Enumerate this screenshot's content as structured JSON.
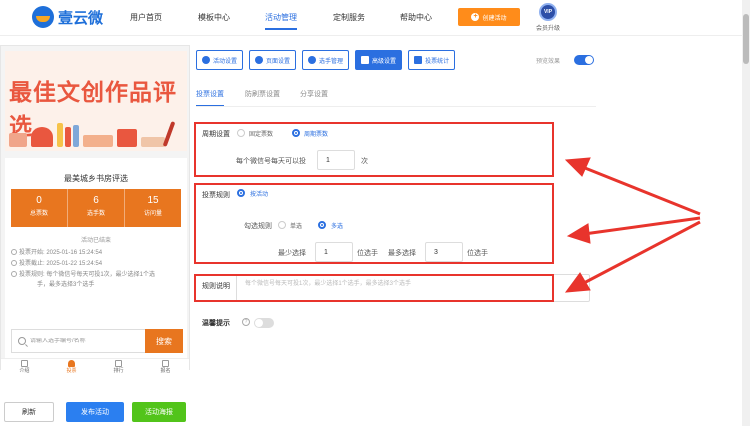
{
  "header": {
    "logo_text": "壹云微",
    "nav": [
      {
        "label": "用户首页"
      },
      {
        "label": "模板中心"
      },
      {
        "label": "活动管理"
      },
      {
        "label": "定制服务"
      },
      {
        "label": "帮助中心"
      }
    ],
    "create_button": "创建活动",
    "vip_badge": "VIP",
    "vip_label": "会员升级"
  },
  "preview": {
    "banner_title": "最佳文创作品评选",
    "activity_title": "最美城乡书房评选",
    "stats": [
      {
        "value": "0",
        "label": "总票数"
      },
      {
        "value": "6",
        "label": "选手数"
      },
      {
        "value": "15",
        "label": "访问量"
      }
    ],
    "status": "活动已结束",
    "start": "投票开始: 2025-01-16 15:24:54",
    "end": "投票截止: 2025-01-22 15:24:54",
    "rule_line1": "投票规则: 每个微信号每天可投1次，最少选择1个选",
    "rule_line2": "手，最多选择3个选手",
    "search_placeholder": "请输入选手编号/名称",
    "search_button": "搜索",
    "tabbar": [
      "介绍",
      "投票",
      "排行",
      "报名"
    ]
  },
  "bottom_buttons": {
    "refresh": "刷新",
    "publish": "发布活动",
    "poster": "活动海报"
  },
  "toolbar": {
    "items": [
      {
        "label": "活动设置"
      },
      {
        "label": "页面设置"
      },
      {
        "label": "选手管理"
      },
      {
        "label": "高级设置"
      },
      {
        "label": "投票统计"
      }
    ],
    "preview_effect": "预览效果",
    "preview_effect_on": true
  },
  "subtabs": [
    "投票设置",
    "防刷票设置",
    "分享设置"
  ],
  "cycle": {
    "label": "周期设置",
    "options": [
      "固定票数",
      "周期票数"
    ],
    "selected": "周期票数",
    "per_day_label": "每个微信号每天可以投",
    "per_day_value": "1",
    "per_day_unit": "次"
  },
  "rules": {
    "label": "投票规则",
    "rule_option": "按活动",
    "check_label": "勾选规则",
    "check_options": [
      "单选",
      "多选"
    ],
    "check_selected": "多选",
    "min_label": "最少选择",
    "min_value": "1",
    "min_unit": "位选手",
    "max_label": "最多选择",
    "max_value": "3",
    "max_unit": "位选手"
  },
  "explain": {
    "label": "规则说明",
    "placeholder": "每个微信号每天可投1次，最少选择1个选手，最多选择3个选手"
  },
  "tip": {
    "label": "温馨提示",
    "icon": "?",
    "enabled": false
  },
  "colors": {
    "primary": "#2b6fe0",
    "orange": "#e8761f",
    "green": "#52c41a",
    "annotation_red": "#e8342c"
  }
}
